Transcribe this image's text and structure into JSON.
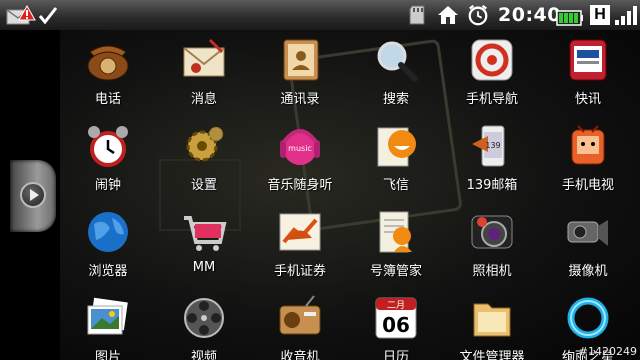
{
  "status_bar": {
    "time": "20:40",
    "icons": [
      "mail-icon",
      "warning-icon",
      "check-icon",
      "sdcard-icon",
      "home-icon",
      "alarm-icon",
      "battery-icon",
      "h-network-icon",
      "signal-icon"
    ],
    "h_label": "H"
  },
  "apps": [
    {
      "label": "电话",
      "icon": "phone-icon"
    },
    {
      "label": "消息",
      "icon": "message-icon"
    },
    {
      "label": "通讯录",
      "icon": "contacts-icon"
    },
    {
      "label": "搜索",
      "icon": "search-icon"
    },
    {
      "label": "手机导航",
      "icon": "navigation-icon"
    },
    {
      "label": "快讯",
      "icon": "news-icon"
    },
    {
      "label": "闹钟",
      "icon": "alarm-clock-icon"
    },
    {
      "label": "设置",
      "icon": "settings-icon"
    },
    {
      "label": "音乐随身听",
      "icon": "music-icon"
    },
    {
      "label": "飞信",
      "icon": "fetion-icon"
    },
    {
      "label": "139邮箱",
      "icon": "mail139-icon"
    },
    {
      "label": "手机电视",
      "icon": "mobile-tv-icon"
    },
    {
      "label": "浏览器",
      "icon": "browser-icon"
    },
    {
      "label": "MM",
      "icon": "mm-store-icon"
    },
    {
      "label": "手机证券",
      "icon": "stocks-icon"
    },
    {
      "label": "号簿管家",
      "icon": "phonebook-icon"
    },
    {
      "label": "照相机",
      "icon": "camera-icon"
    },
    {
      "label": "摄像机",
      "icon": "camcorder-icon"
    },
    {
      "label": "图片",
      "icon": "gallery-icon"
    },
    {
      "label": "视频",
      "icon": "video-icon"
    },
    {
      "label": "收音机",
      "icon": "radio-icon"
    },
    {
      "label": "日历",
      "icon": "calendar-icon"
    },
    {
      "label": "文件管理器",
      "icon": "file-manager-icon"
    },
    {
      "label": "绚丽之星",
      "icon": "ring-icon"
    }
  ],
  "calendar": {
    "month": "二月",
    "day": "06"
  },
  "mail139_label": "139",
  "music_text": "music",
  "watermark": "#1420249"
}
